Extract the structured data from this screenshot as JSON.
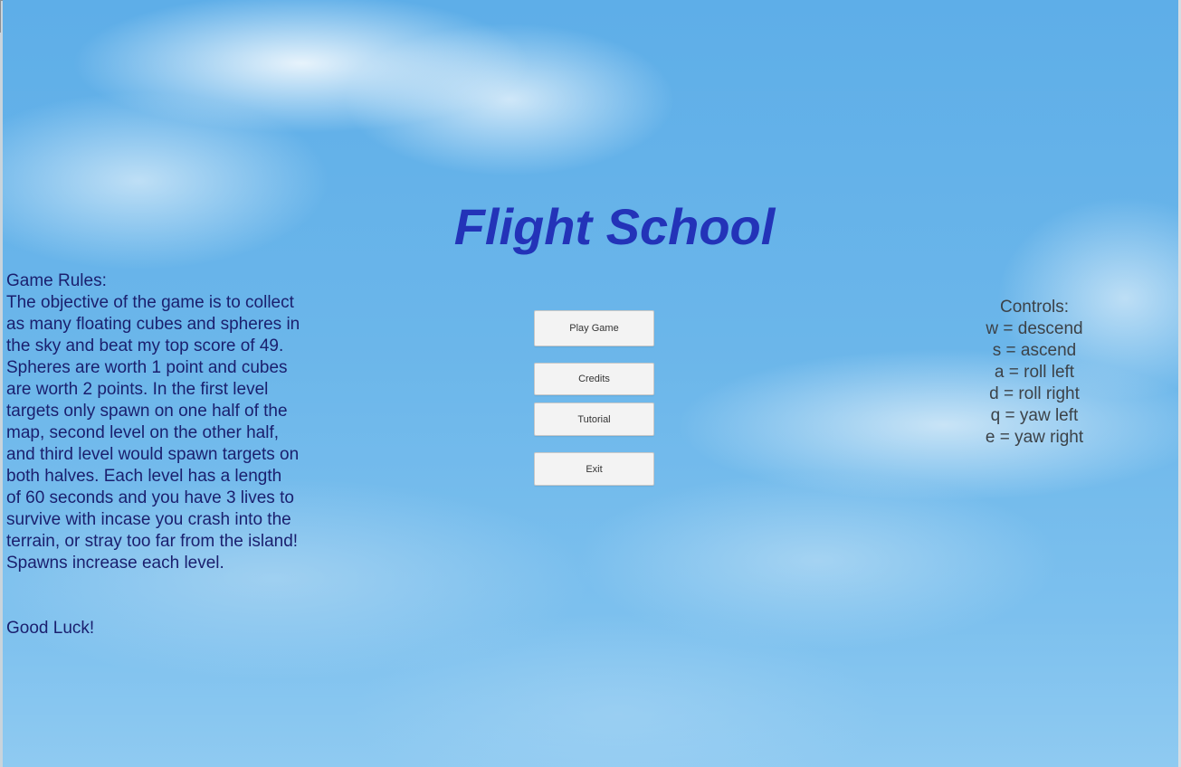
{
  "title": "Flight School",
  "menu": {
    "play_label": "Play Game",
    "credits_label": "Credits",
    "tutorial_label": "Tutorial",
    "exit_label": "Exit"
  },
  "rules": {
    "heading": "Game Rules:",
    "body": "The objective of the game is to collect as many floating cubes and spheres in the sky and beat my top score of 49. Spheres are worth 1 point and cubes are worth 2 points. In the first level targets only spawn on one half of the map, second level on the other half, and third level would spawn targets on both halves. Each level has a length of 60 seconds and you have 3 lives to survive with incase you crash into the terrain, or stray too far from the island! Spawns increase each level.",
    "closing": "Good Luck!"
  },
  "controls": {
    "heading": "Controls:",
    "items": [
      "w = descend",
      "s = ascend",
      "a = roll left",
      "d = roll right",
      "q = yaw left",
      "e = yaw right"
    ]
  },
  "colors": {
    "title": "#2333b8",
    "rules_text": "#1a1f6e",
    "controls_text": "#3c4248",
    "sky": "#6bb6ea",
    "button_bg": "#f3f3f3"
  }
}
